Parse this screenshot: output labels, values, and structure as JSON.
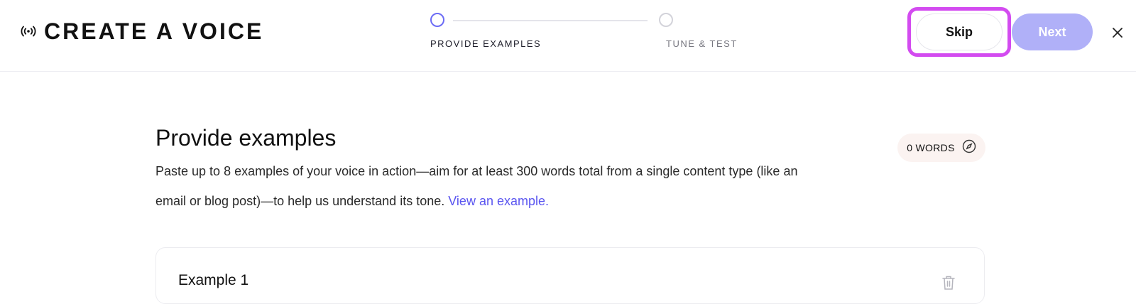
{
  "header": {
    "title": "CREATE A VOICE",
    "brand_icon": "broadcast-icon"
  },
  "stepper": {
    "steps": [
      {
        "label": "PROVIDE EXAMPLES",
        "state": "active"
      },
      {
        "label": "TUNE & TEST",
        "state": "inactive"
      }
    ]
  },
  "actions": {
    "skip_label": "Skip",
    "next_label": "Next",
    "close_icon": "close-icon"
  },
  "main": {
    "title": "Provide examples",
    "description": "Paste up to 8 examples of your voice in action—aim for at least 300 words total from a single content type (like an email or blog post)—to help us understand its tone.",
    "example_link": "View an example.",
    "word_count": "0 WORDS",
    "word_count_icon": "compass-icon"
  },
  "examples": [
    {
      "title": "Example 1",
      "delete_icon": "trash-icon"
    }
  ],
  "colors": {
    "accent": "#5a55f0",
    "next_button_disabled": "#b0b0f8",
    "highlight_outline": "#d34bf0",
    "words_badge_bg": "#fbf3f1"
  }
}
